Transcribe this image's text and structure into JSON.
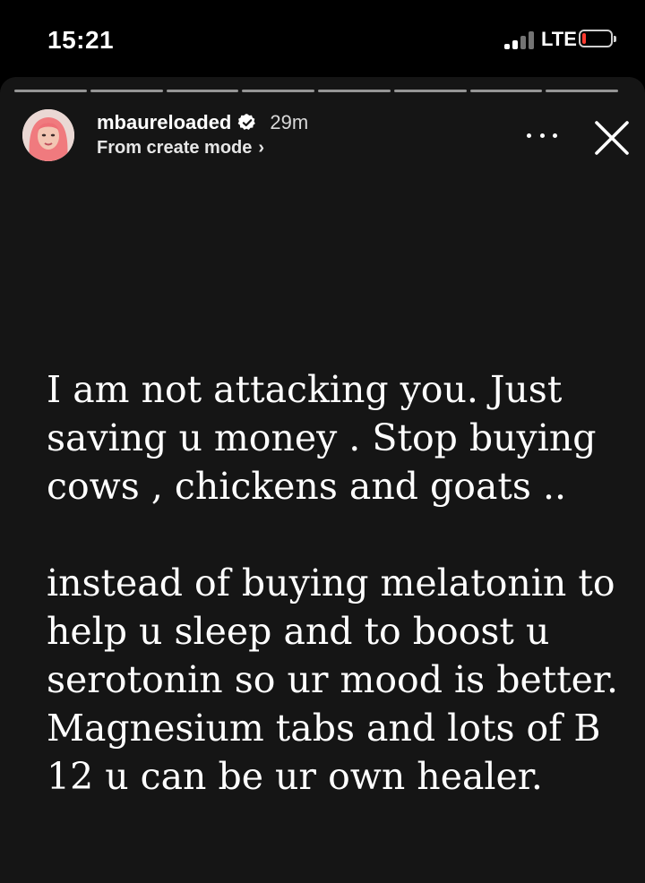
{
  "status_bar": {
    "time": "15:21",
    "network": "LTE"
  },
  "story": {
    "segments_total": 8,
    "segments_viewed": 0,
    "username": "mbaureloaded",
    "verified": true,
    "time_ago": "29m",
    "subtitle": "From create mode",
    "paragraph1": "I am not attacking you. Just saving u money . Stop buying cows , chickens and goats ..",
    "paragraph2": "instead of buying melatonin to help u sleep and to boost u serotonin so ur mood is better. Magnesium tabs and lots of B 12  u can be ur own healer."
  },
  "icons": {
    "signal": "signal-bars-icon",
    "battery": "battery-low-icon",
    "verified": "verified-badge-icon",
    "more": "more-options-icon",
    "close": "close-icon"
  },
  "colors": {
    "story_background": "#151515",
    "battery_low": "#ff3b30"
  }
}
